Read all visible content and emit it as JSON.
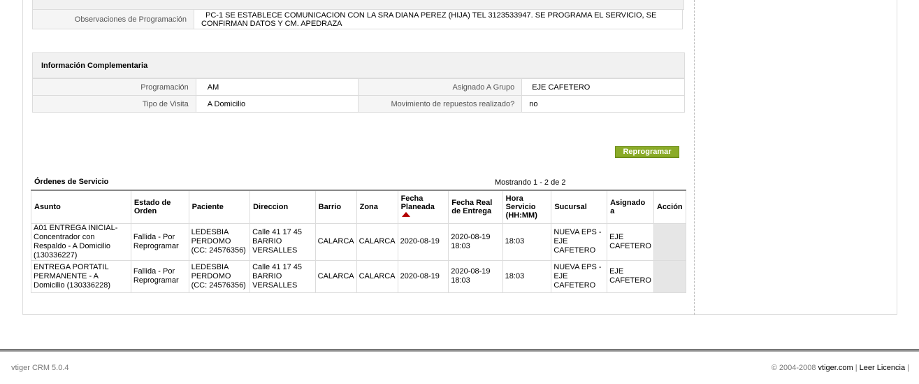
{
  "detail": {
    "observaciones_label": "Observaciones de Programación",
    "observaciones_value": "PC-1 SE ESTABLECE COMUNICACION CON LA SRA DIANA PEREZ (HIJA) TEL 3123533947. SE PROGRAMA EL SERVICIO, SE CONFIRMAN DATOS Y CM. APEDRAZA"
  },
  "info": {
    "header": "Información Complementaria",
    "rows": [
      {
        "label1": "Programación",
        "value1": "AM",
        "label2": "Asignado A Grupo",
        "value2": "EJE CAFETERO"
      },
      {
        "label1": "Tipo de Visita",
        "value1": "A Domicilio",
        "label2": "Movimiento de repuestos realizado?",
        "value2": "no"
      }
    ]
  },
  "reprogramar_label": "Reprogramar",
  "orders": {
    "title": "Órdenes de Servicio",
    "count": "Mostrando 1 - 2 de 2",
    "headers": {
      "asunto": "Asunto",
      "estado": "Estado de Orden",
      "paciente": "Paciente",
      "direccion": "Direccion",
      "barrio": "Barrio",
      "zona": "Zona",
      "fecha_planeada": "Fecha Planeada",
      "fecha_real": "Fecha Real de Entrega",
      "hora": "Hora Servicio (HH:MM)",
      "sucursal": "Sucursal",
      "asignado": "Asignado a",
      "accion": "Acción"
    },
    "rows": [
      {
        "asunto": "A01 ENTREGA INICIAL-Concentrador con Respaldo - A Domicilio (130336227)",
        "estado": "Fallida - Por Reprogramar",
        "paciente": "LEDESBIA PERDOMO (CC: 24576356)",
        "direccion": "Calle 41 17 45 BARRIO VERSALLES",
        "barrio": "CALARCA",
        "zona": "CALARCA",
        "fecha_planeada": "2020-08-19",
        "fecha_real": "2020-08-19 18:03",
        "hora": "18:03",
        "sucursal": "NUEVA EPS - EJE CAFETERO",
        "asignado": "EJE CAFETERO",
        "accion": ""
      },
      {
        "asunto": "ENTREGA PORTATIL PERMANENTE - A Domicilio (130336228)",
        "estado": "Fallida - Por Reprogramar",
        "paciente": "LEDESBIA PERDOMO (CC: 24576356)",
        "direccion": "Calle 41 17 45 BARRIO VERSALLES",
        "barrio": "CALARCA",
        "zona": "CALARCA",
        "fecha_planeada": "2020-08-19",
        "fecha_real": "2020-08-19 18:03",
        "hora": "18:03",
        "sucursal": "NUEVA EPS - EJE CAFETERO",
        "asignado": "EJE CAFETERO",
        "accion": ""
      }
    ]
  },
  "footer": {
    "version": "vtiger CRM 5.0.4",
    "copyright": "© 2004-2008",
    "vtiger_link": "vtiger.com",
    "license_link": "Leer Licencia",
    "separator": "|"
  }
}
